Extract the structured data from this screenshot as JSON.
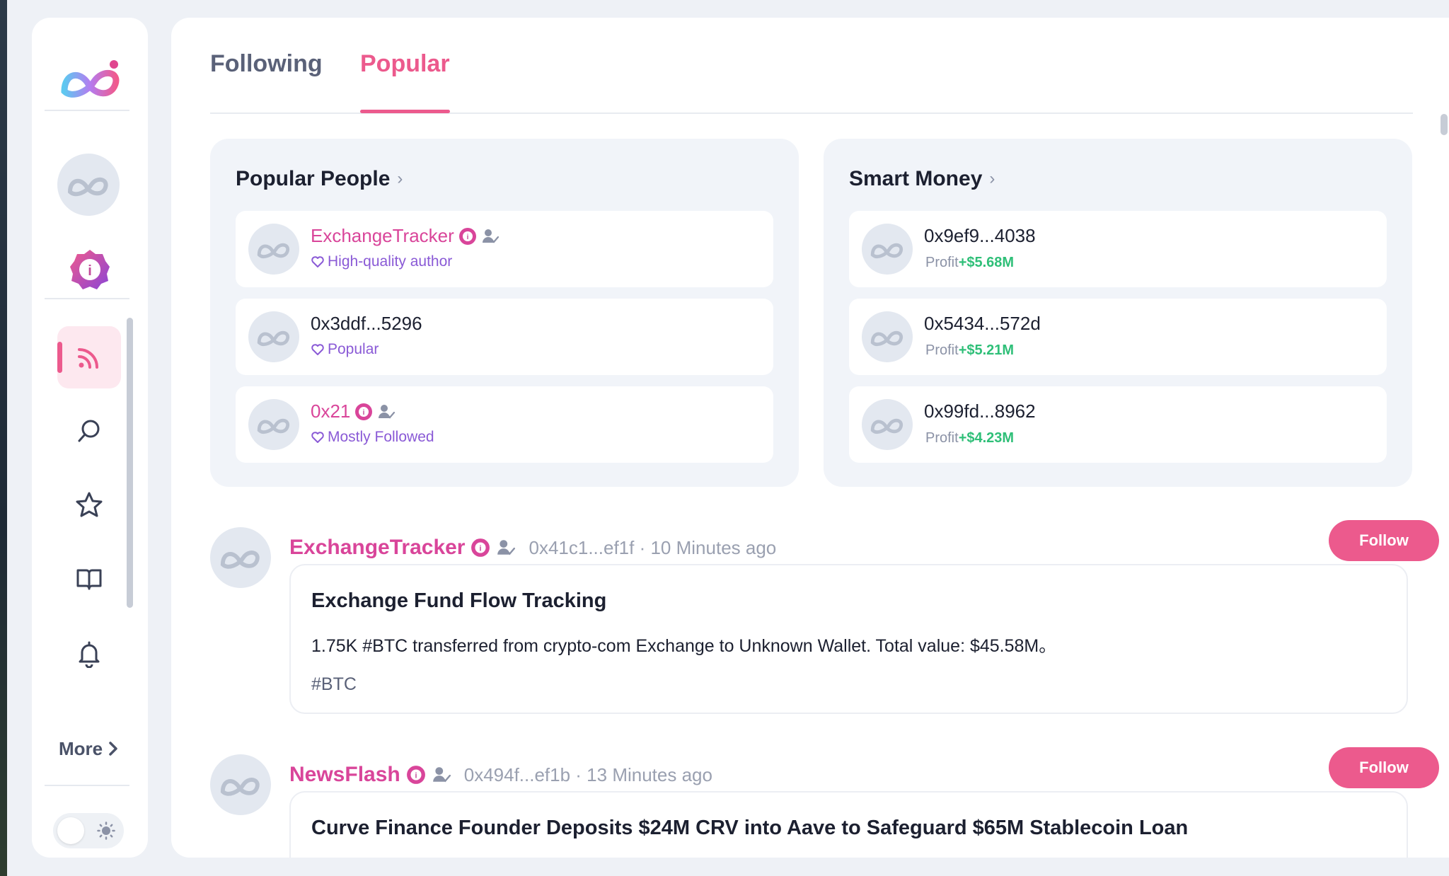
{
  "sidebar": {
    "more_label": "More",
    "nav": [
      {
        "icon": "rss-icon",
        "active": true
      },
      {
        "icon": "search-icon",
        "active": false
      },
      {
        "icon": "star-icon",
        "active": false
      },
      {
        "icon": "book-icon",
        "active": false
      },
      {
        "icon": "bell-icon",
        "active": false
      }
    ]
  },
  "tabs": [
    {
      "label": "Following",
      "active": false
    },
    {
      "label": "Popular",
      "active": true
    }
  ],
  "popular_people": {
    "title": "Popular People",
    "items": [
      {
        "name": "ExchangeTracker",
        "verified": true,
        "sub": "High-quality author"
      },
      {
        "name": "0x3ddf...5296",
        "verified": false,
        "sub": "Popular"
      },
      {
        "name": "0x21",
        "verified": true,
        "sub": "Mostly Followed"
      }
    ]
  },
  "smart_money": {
    "title": "Smart Money",
    "items": [
      {
        "address": "0x9ef9...4038",
        "profit_label": "Profit",
        "profit_value": "+$5.68M"
      },
      {
        "address": "0x5434...572d",
        "profit_label": "Profit",
        "profit_value": "+$5.21M"
      },
      {
        "address": "0x99fd...8962",
        "profit_label": "Profit",
        "profit_value": "+$4.23M"
      }
    ]
  },
  "posts": [
    {
      "author": "ExchangeTracker",
      "meta": "0x41c1...ef1f · 10 Minutes ago",
      "follow_label": "Follow",
      "title": "Exchange Fund Flow Tracking",
      "body": "1.75K #BTC transferred from crypto-com Exchange to Unknown Wallet. Total value: $45.58M。",
      "tag": "#BTC"
    },
    {
      "author": "NewsFlash",
      "meta": "0x494f...ef1b · 13 Minutes ago",
      "follow_label": "Follow",
      "title": "Curve Finance Founder Deposits $24M CRV into Aave to Safeguard $65M Stablecoin Loan"
    }
  ],
  "colors": {
    "accent": "#ec5a8d",
    "author_pink": "#d9459a",
    "tag_purple": "#8a5ad6",
    "profit_green": "#2fbf78",
    "card_bg": "#f1f4f9"
  }
}
